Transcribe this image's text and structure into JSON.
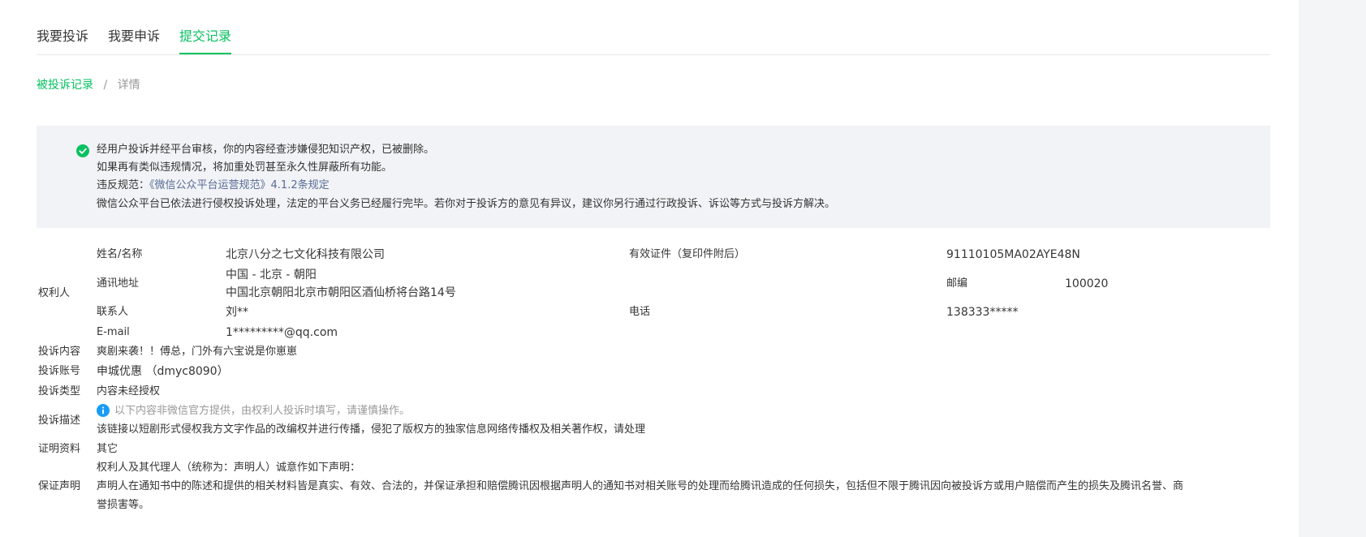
{
  "tabs": [
    {
      "label": "我要投诉"
    },
    {
      "label": "我要申诉"
    },
    {
      "label": "提交记录"
    }
  ],
  "breadcrumb": {
    "parent": "被投诉记录",
    "separator": "/",
    "current": "详情"
  },
  "notice": {
    "line1": "经用户投诉并经平台审核，你的内容经查涉嫌侵犯知识产权，已被删除。",
    "line2": "如果再有类似违规情况，将加重处罚甚至永久性屏蔽所有功能。",
    "violation_prefix": "违反规范：",
    "violation_link": "《微信公众平台运营规范》4.1.2条规定",
    "line4": "微信公众平台已依法进行侵权投诉处理，法定的平台义务已经履行完毕。若你对于投诉方的意见有异议，建议你另行通过行政投诉、诉讼等方式与投诉方解决。"
  },
  "rights_holder": {
    "section_label": "权利人",
    "name_label": "姓名/名称",
    "name_value": "北京八分之七文化科技有限公司",
    "cert_label": "有效证件（复印件附后）",
    "cert_value": "91110105MA02AYE48N",
    "address_label": "通讯地址",
    "address_line1": "中国 - 北京 - 朝阳",
    "address_line2": "中国北京朝阳北京市朝阳区酒仙桥将台路14号",
    "postcode_label": "邮编",
    "postcode_value": "100020",
    "contact_label": "联系人",
    "contact_value": "刘**",
    "phone_label": "电话",
    "phone_value": "138333*****",
    "email_label": "E-mail",
    "email_value": "1*********@qq.com"
  },
  "complaint": {
    "content_label": "投诉内容",
    "content_value": "爽剧来袭！！傅总，门外有六宝说是你崽崽",
    "account_label": "投诉账号",
    "account_value": "申城优惠 （dmyc8090）",
    "type_label": "投诉类型",
    "type_value": "内容未经授权",
    "desc_label": "投诉描述",
    "desc_hint": "以下内容非微信官方提供，由权利人投诉时填写，请谨慎操作。",
    "desc_value": "该链接以短剧形式侵权我方文字作品的改编权并进行传播，侵犯了版权方的独家信息网络传播权及相关著作权，请处理",
    "proof_label": "证明资料",
    "proof_value": "其它",
    "guarantee_label": "保证声明",
    "guarantee_line1": "权利人及其代理人（统称为：声明人）诚意作如下声明：",
    "guarantee_line2": "声明人在通知书中的陈述和提供的相关材料皆是真实、有效、合法的，并保证承担和赔偿腾讯因根据声明人的通知书对相关账号的处理而给腾讯造成的任何损失，包括但不限于腾讯因向被投诉方或用户赔偿而产生的损失及腾讯名誉、商",
    "guarantee_line3": "誉损害等。"
  },
  "colors": {
    "accent": "#07c160",
    "link": "#576b95",
    "info": "#1a9cf5"
  }
}
